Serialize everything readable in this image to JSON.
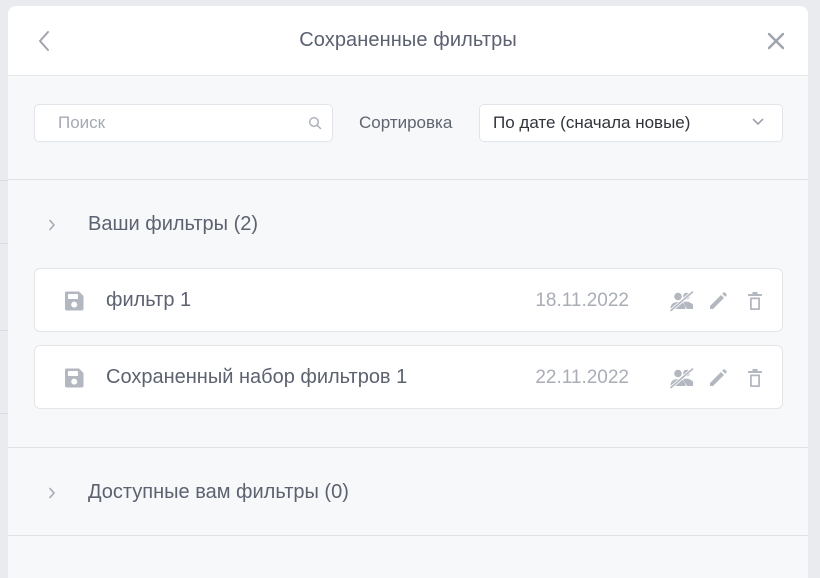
{
  "header": {
    "title": "Сохраненные фильтры"
  },
  "toolbar": {
    "search_placeholder": "Поиск",
    "search_value": "",
    "sort_label": "Сортировка",
    "sort_value": "По дате (сначала новые)"
  },
  "sections": {
    "own": {
      "label": "Ваши фильтры (2)",
      "items": [
        {
          "name": "фильтр 1",
          "date": "18.11.2022"
        },
        {
          "name": "Сохраненный набор фильтров 1",
          "date": "22.11.2022"
        }
      ]
    },
    "shared": {
      "label": "Доступные вам фильтры (0)"
    }
  },
  "colors": {
    "icon": "#b3b7c0",
    "muted_text": "#a9adb6",
    "text": "#5c6270",
    "modal_bg": "#f7f8fa"
  }
}
